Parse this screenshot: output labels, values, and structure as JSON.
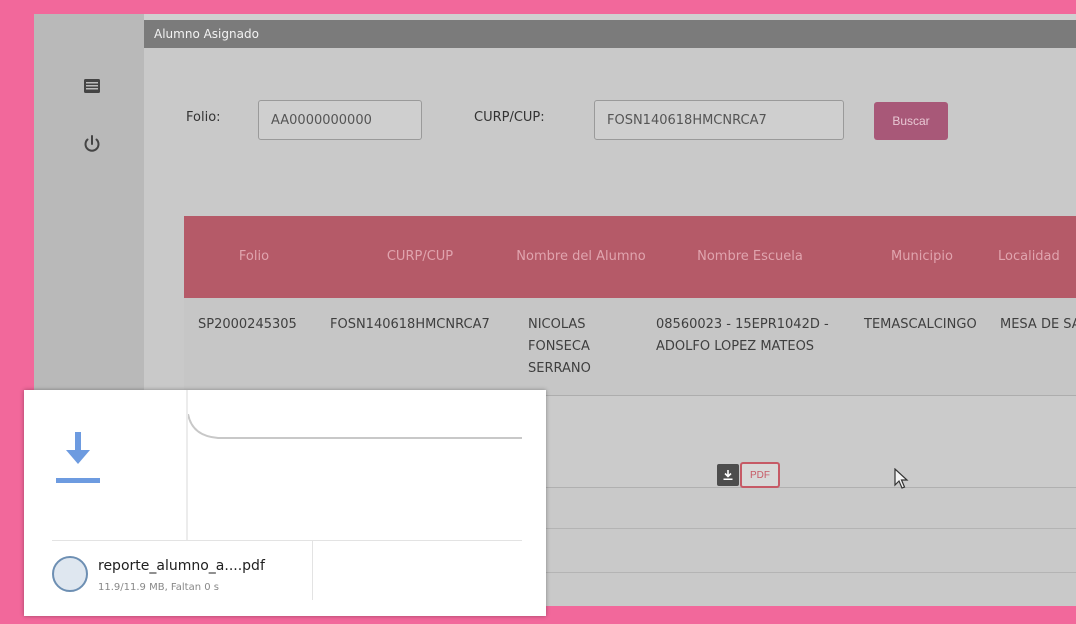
{
  "sidebar": {
    "icons": [
      "list-icon",
      "power-icon"
    ]
  },
  "panel": {
    "title": "Alumno Asignado"
  },
  "search": {
    "folio_label": "Folio:",
    "folio_value": "AA0000000000",
    "curp_label": "CURP/CUP:",
    "curp_value": "FOSN140618HMCNRCA7",
    "button_label": "Buscar"
  },
  "table": {
    "headers": [
      "Folio",
      "CURP/CUP",
      "Nombre del Alumno",
      "Nombre Escuela",
      "Municipio",
      "Localidad"
    ],
    "rows": [
      {
        "folio": "SP2000245305",
        "curp": "FOSN140618HMCNRCA7",
        "nombre": "NICOLAS FONSECA SERRANO",
        "escuela": "08560023 - 15EPR1042D - ADOLFO LOPEZ MATEOS",
        "municipio": "TEMASCALCINGO",
        "localidad": "MESA DE SANTIAGO"
      }
    ]
  },
  "actions": {
    "pdf_label": "PDF"
  },
  "colors": {
    "accent": "#b55a68",
    "button": "#a85878",
    "background": "#f2689b"
  },
  "download_popup": {
    "filename": "reporte_alumno_a....pdf",
    "status": "11.9/11.9 MB, Faltan 0 s"
  }
}
